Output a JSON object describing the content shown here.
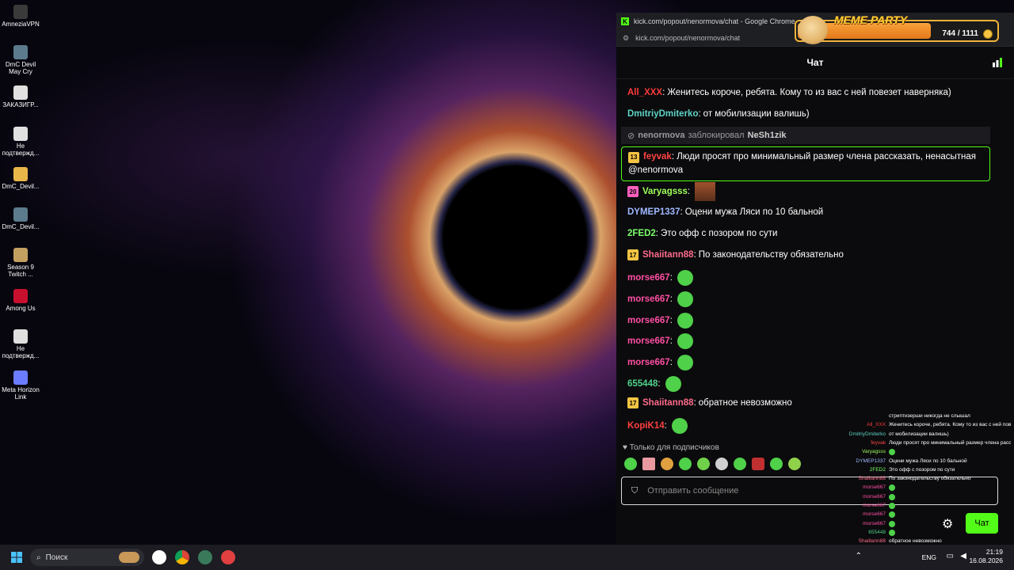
{
  "desktop_icons": [
    {
      "label": "AmneziaVPN",
      "color": "#3a3a3a"
    },
    {
      "label": "DmC Devil May Cry",
      "color": "#5c7b8c"
    },
    {
      "label": "ЗАКАЗИГР...",
      "color": "#e0e0e0"
    },
    {
      "label": "Не подтвержд...",
      "color": "#e0e0e0"
    },
    {
      "label": "DmC_Devil...",
      "color": "#e8b74a"
    },
    {
      "label": "DmC_Devil...",
      "color": "#5c7b8c"
    },
    {
      "label": "Season 9 Twitch ...",
      "color": "#c4a060"
    },
    {
      "label": "Among Us",
      "color": "#c8102e"
    },
    {
      "label": "Не подтвержд...",
      "color": "#e0e0e0"
    },
    {
      "label": "Meta Horizon Link",
      "color": "#6b7cff"
    }
  ],
  "browser": {
    "window_title": "kick.com/popout/nenormova/chat - Google Chrome",
    "url": "kick.com/popout/nenormova/chat"
  },
  "chat": {
    "header_title": "Чат",
    "messages": [
      {
        "user": "All_XXX",
        "color": "#ff3b3b",
        "text": "Женитесь короче, ребята. Кому то из вас с ней повезет наверняка)"
      },
      {
        "user": "DmitriyDmiterko",
        "color": "#5fd3c4",
        "text": "от мобилизации валишь)"
      },
      {
        "user": "DYMEP1337",
        "color": "#9fb8ff",
        "text": "Оцени мужа Ляси по 10 бальной"
      },
      {
        "user": "2FED2",
        "color": "#7cff6b",
        "text": "Это офф с позором по сути"
      },
      {
        "user": "Shaiitann88",
        "color": "#ff6b8b",
        "text": "По законодательству обязательно",
        "badge": "17"
      },
      {
        "user": "morse667",
        "color": "#ff4fa3",
        "text": ""
      },
      {
        "user": "morse667",
        "color": "#ff4fa3",
        "text": ""
      },
      {
        "user": "morse667",
        "color": "#ff4fa3",
        "text": ""
      },
      {
        "user": "morse667",
        "color": "#ff4fa3",
        "text": ""
      },
      {
        "user": "morse667",
        "color": "#ff4fa3",
        "text": ""
      },
      {
        "user": "655448",
        "color": "#4fd18a",
        "text": ""
      },
      {
        "user": "Shaiitann88",
        "color": "#ff6b8b",
        "text": "обратное невозможно",
        "badge": "17"
      },
      {
        "user": "KopiK14",
        "color": "#ff4040",
        "text": ""
      }
    ],
    "system_message": {
      "moderator": "nenormova",
      "action": "заблокировал",
      "target": "NeSh1zik"
    },
    "highlight_message": {
      "user": "feyvak",
      "color": "#ff4444",
      "badge": "13",
      "text": "Люди просят про минимальный размер члена рассказать, ненасытная @nenormova"
    },
    "varyag_message": {
      "user": "Varyagsss",
      "color": "#9fff5c",
      "badge": "20"
    },
    "subscribers_label": "Только для подписчиков",
    "input_placeholder": "Отправить сообщение",
    "send_label": "Чат"
  },
  "widget": {
    "title": "MEME PARTY",
    "count": "744 / 1111",
    "progress": 0.67
  },
  "mini_chat": [
    {
      "user": "",
      "text": "стриптизерши никогда не слышал",
      "color": "#ffffff"
    },
    {
      "user": "All_XXX",
      "text": "Женитесь короче, ребята. Кому то из вас с ней повезет наверняка)",
      "color": "#ff3b3b"
    },
    {
      "user": "DmitriyDmiterko",
      "text": "от мобилизации валишь)",
      "color": "#5fd3c4"
    },
    {
      "user": "feyvak",
      "text": "Люди просят про минимальный размер члена рассказать, ненасытная @nenormova",
      "color": "#ff4444"
    },
    {
      "user": "Varyagsss",
      "text": "",
      "color": "#9fff5c"
    },
    {
      "user": "DYMEP1337",
      "text": "Оцени мужа Ляси по 10 бальной",
      "color": "#9fb8ff"
    },
    {
      "user": "2FED2",
      "text": "Это офф с позором по сути",
      "color": "#7cff6b"
    },
    {
      "user": "Shaiitann88",
      "text": "По законодательству обязательно",
      "color": "#ff6b8b"
    },
    {
      "user": "morse667",
      "text": "",
      "color": "#ff4fa3"
    },
    {
      "user": "morse667",
      "text": "",
      "color": "#ff4fa3"
    },
    {
      "user": "morse667",
      "text": "",
      "color": "#ff4fa3"
    },
    {
      "user": "morse667",
      "text": "",
      "color": "#ff4fa3"
    },
    {
      "user": "morse667",
      "text": "",
      "color": "#ff4fa3"
    },
    {
      "user": "655448",
      "text": "",
      "color": "#4fd18a"
    },
    {
      "user": "Shaiitann88",
      "text": "обратное невозможно",
      "color": "#ff6b8b"
    },
    {
      "user": "KopiK14",
      "text": "",
      "color": "#ff4040"
    }
  ],
  "taskbar": {
    "search_placeholder": "Поиск",
    "language": "ENG",
    "time": "21:19",
    "date": "16.08.2026"
  }
}
